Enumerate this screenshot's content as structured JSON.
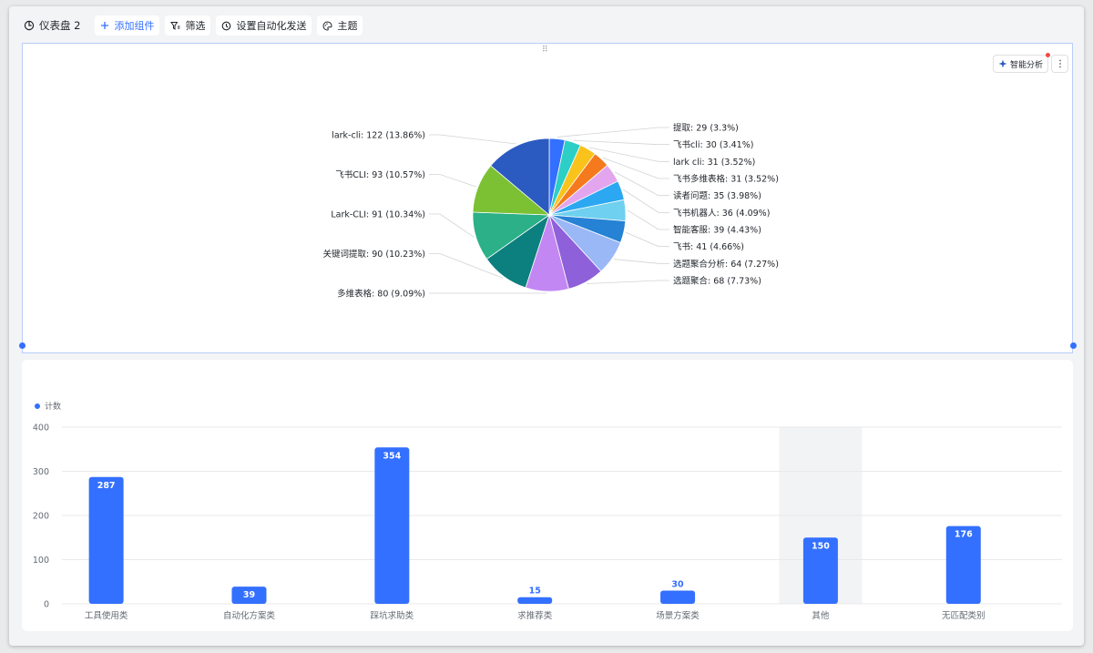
{
  "toolbar": {
    "dashboard_title": "仪表盘 2",
    "add_component": "添加组件",
    "filter": "筛选",
    "auto_send": "设置自动化发送",
    "theme": "主题"
  },
  "pie_card": {
    "smart_analysis": "智能分析"
  },
  "chart_data": [
    {
      "type": "pie",
      "slices": [
        {
          "label": "提取",
          "value": 29,
          "percent": "3.3%",
          "color": "#3370ff"
        },
        {
          "label": "飞书cli",
          "value": 30,
          "percent": "3.41%",
          "color": "#2ccfc6"
        },
        {
          "label": "lark cli",
          "value": 31,
          "percent": "3.52%",
          "color": "#fac31b"
        },
        {
          "label": "飞书多维表格",
          "value": 31,
          "percent": "3.52%",
          "color": "#f47a1d"
        },
        {
          "label": "读者问题",
          "value": 35,
          "percent": "3.98%",
          "color": "#e2a5ee"
        },
        {
          "label": "飞书机器人",
          "value": 36,
          "percent": "4.09%",
          "color": "#2ba8f1"
        },
        {
          "label": "智能客服",
          "value": 39,
          "percent": "4.43%",
          "color": "#6fd0ef"
        },
        {
          "label": "飞书",
          "value": 41,
          "percent": "4.66%",
          "color": "#2682d4"
        },
        {
          "label": "选题聚合分析",
          "value": 64,
          "percent": "7.27%",
          "color": "#9ab7f6"
        },
        {
          "label": "选题聚合",
          "value": 68,
          "percent": "7.73%",
          "color": "#8e60d9"
        },
        {
          "label": "多维表格",
          "value": 80,
          "percent": "9.09%",
          "color": "#c287f2"
        },
        {
          "label": "关键词提取",
          "value": 90,
          "percent": "10.23%",
          "color": "#0c7f7f"
        },
        {
          "label": "Lark-CLI",
          "value": 91,
          "percent": "10.34%",
          "color": "#2bb087"
        },
        {
          "label": "飞书CLI",
          "value": 93,
          "percent": "10.57%",
          "color": "#7cc133"
        },
        {
          "label": "lark-cli",
          "value": 122,
          "percent": "13.86%",
          "color": "#2b5ac0"
        }
      ]
    },
    {
      "type": "bar",
      "legend": [
        "计数"
      ],
      "categories": [
        "工具使用类",
        "自动化方案类",
        "踩坑求助类",
        "求推荐类",
        "场景方案类",
        "其他",
        "无匹配类别"
      ],
      "values": [
        287,
        39,
        354,
        15,
        30,
        150,
        176
      ],
      "y_ticks": [
        0,
        100,
        200,
        300,
        400
      ],
      "ylim": [
        0,
        400
      ],
      "color": "#3370ff",
      "highlight_category": "其他"
    }
  ]
}
